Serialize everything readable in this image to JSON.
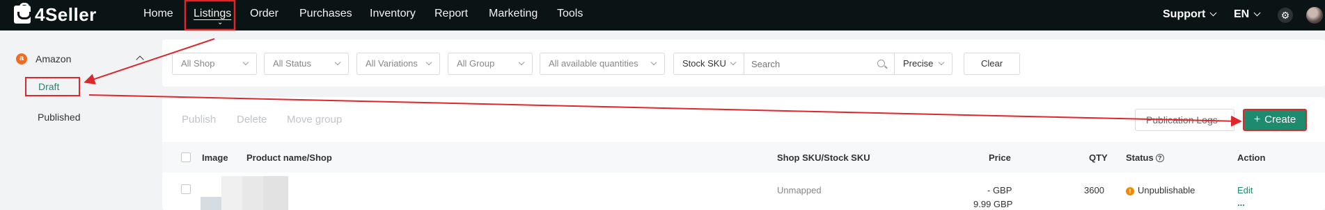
{
  "app": {
    "brand": "4Seller"
  },
  "nav": {
    "items": [
      {
        "label": "Home"
      },
      {
        "label": "Listings"
      },
      {
        "label": "Order"
      },
      {
        "label": "Purchases"
      },
      {
        "label": "Inventory"
      },
      {
        "label": "Report"
      },
      {
        "label": "Marketing"
      },
      {
        "label": "Tools"
      }
    ],
    "active": "Listings",
    "right": {
      "support": "Support",
      "language": "EN"
    }
  },
  "sidebar": {
    "platform": {
      "badge": "a",
      "label": "Amazon"
    },
    "items": [
      {
        "label": "Draft",
        "active": true
      },
      {
        "label": "Published",
        "active": false
      }
    ]
  },
  "filters": {
    "shop": "All Shop",
    "status": "All Status",
    "variations": "All Variations",
    "group": "All Group",
    "quantities": "All available quantities",
    "sku_type": "Stock SKU",
    "search_placeholder": "Search",
    "match": "Precise",
    "clear": "Clear"
  },
  "actions": {
    "publish": "Publish",
    "delete": "Delete",
    "move_group": "Move group",
    "publication_logs": "Publication Logs",
    "create": "Create"
  },
  "table": {
    "columns": {
      "image": "Image",
      "product": "Product name/Shop",
      "sku": "Shop SKU/Stock SKU",
      "price": "Price",
      "qty": "QTY",
      "status": "Status",
      "action": "Action"
    },
    "rows": [
      {
        "sku": "Unmapped",
        "price_line1": "- GBP",
        "price_line2": "9.99 GBP",
        "qty": "3600",
        "status": "Unpublishable",
        "edit": "Edit",
        "more": "..."
      }
    ]
  },
  "colors": {
    "nav_bg": "#0b1415",
    "accent": "#1e8a6e",
    "annotation": "#e0262a",
    "warning": "#f28a00",
    "amazon": "#f26b21"
  }
}
